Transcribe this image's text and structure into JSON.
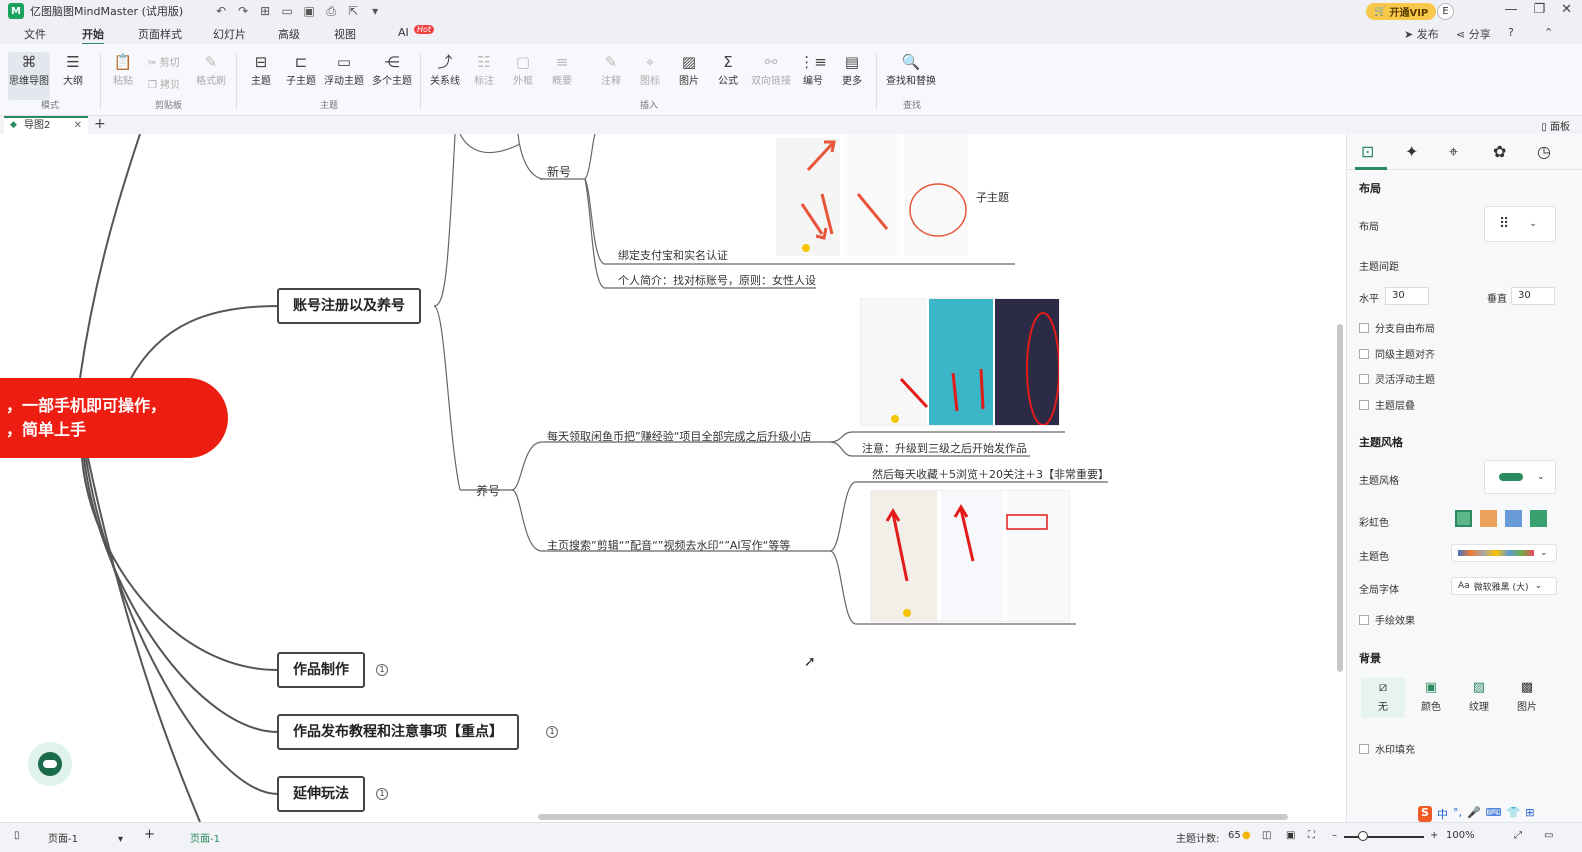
{
  "titlebar": {
    "app_title": "亿图脑图MindMaster (试用版)",
    "vip_label": "开通VIP",
    "user_initial": "E",
    "logo_text": "M"
  },
  "menubar": {
    "items": [
      "文件",
      "开始",
      "页面样式",
      "幻灯片",
      "高级",
      "视图",
      "AI"
    ],
    "hot_badge": "Hot",
    "publish": "发布",
    "share": "分享",
    "help": "?"
  },
  "ribbon": {
    "mode_buttons": [
      "思维导图",
      "大纲"
    ],
    "clipboard_buttons": [
      "粘贴",
      "剪切",
      "拷贝",
      "格式刷"
    ],
    "topic_buttons": [
      "主题",
      "子主题",
      "浮动主题",
      "多个主题"
    ],
    "insert_buttons": [
      "关系线",
      "标注",
      "外框",
      "概要",
      "注释",
      "图标",
      "图片",
      "公式",
      "双向链接",
      "编号",
      "更多"
    ],
    "find_button": "查找和替换",
    "groups": {
      "mode": "模式",
      "clipboard": "剪贴板",
      "topic": "主题",
      "insert": "插入",
      "find": "查找"
    }
  },
  "tabs": {
    "doc_tab": "导图2",
    "panel_toggle": "面板"
  },
  "canvas": {
    "root_line1": "，一部手机即可操作，",
    "root_line2": "，简单上手",
    "main_topics": [
      "账号注册以及养号",
      "作品制作",
      "作品发布教程和注意事项【重点】",
      "延伸玩法"
    ],
    "collapse_count": "1",
    "sub_xinhao": "新号",
    "sub_yanghao": "养号",
    "leaf_bind_alipay": "绑定支付宝和实名认证",
    "leaf_profile": "个人简介：找对标账号，原则：女性人设",
    "leaf_daily": "每天领取闲鱼币把”赚经验“项目全部完成之后升级小店",
    "leaf_note": "注意：升级到三级之后开始发作品",
    "leaf_then": "然后每天收藏＋5浏览＋20关注＋3【非常重要】",
    "leaf_search": "主页搜索”剪辑“”配音“”视频去水印“”AI写作“等等",
    "image_label": "子主题"
  },
  "panel": {
    "section_layout": "布局",
    "layout_label": "布局",
    "spacing_label": "主题间距",
    "horizontal_label": "水平",
    "horizontal_value": "30",
    "vertical_label": "垂直",
    "vertical_value": "30",
    "checkboxes": [
      "分支自由布局",
      "同级主题对齐",
      "灵活浮动主题",
      "主题层叠"
    ],
    "section_style": "主题风格",
    "style_label": "主题风格",
    "rainbow_label": "彩虹色",
    "theme_color_label": "主题色",
    "global_font_label": "全局字体",
    "global_font_value": "微软雅黑 (大)",
    "hand_drawn": "手绘效果",
    "section_bg": "背景",
    "bg_options": [
      "无",
      "颜色",
      "纹理",
      "图片"
    ],
    "watermark": "水印填充"
  },
  "statusbar": {
    "page_select": "页面-1",
    "page_tab": "页面-1",
    "topic_count_label": "主题计数:",
    "topic_count": "65",
    "zoom": "100%"
  },
  "colors": {
    "accent": "#2b8a5e",
    "root_fill": "#ee1d12",
    "annotation_red": "#e8553a"
  }
}
